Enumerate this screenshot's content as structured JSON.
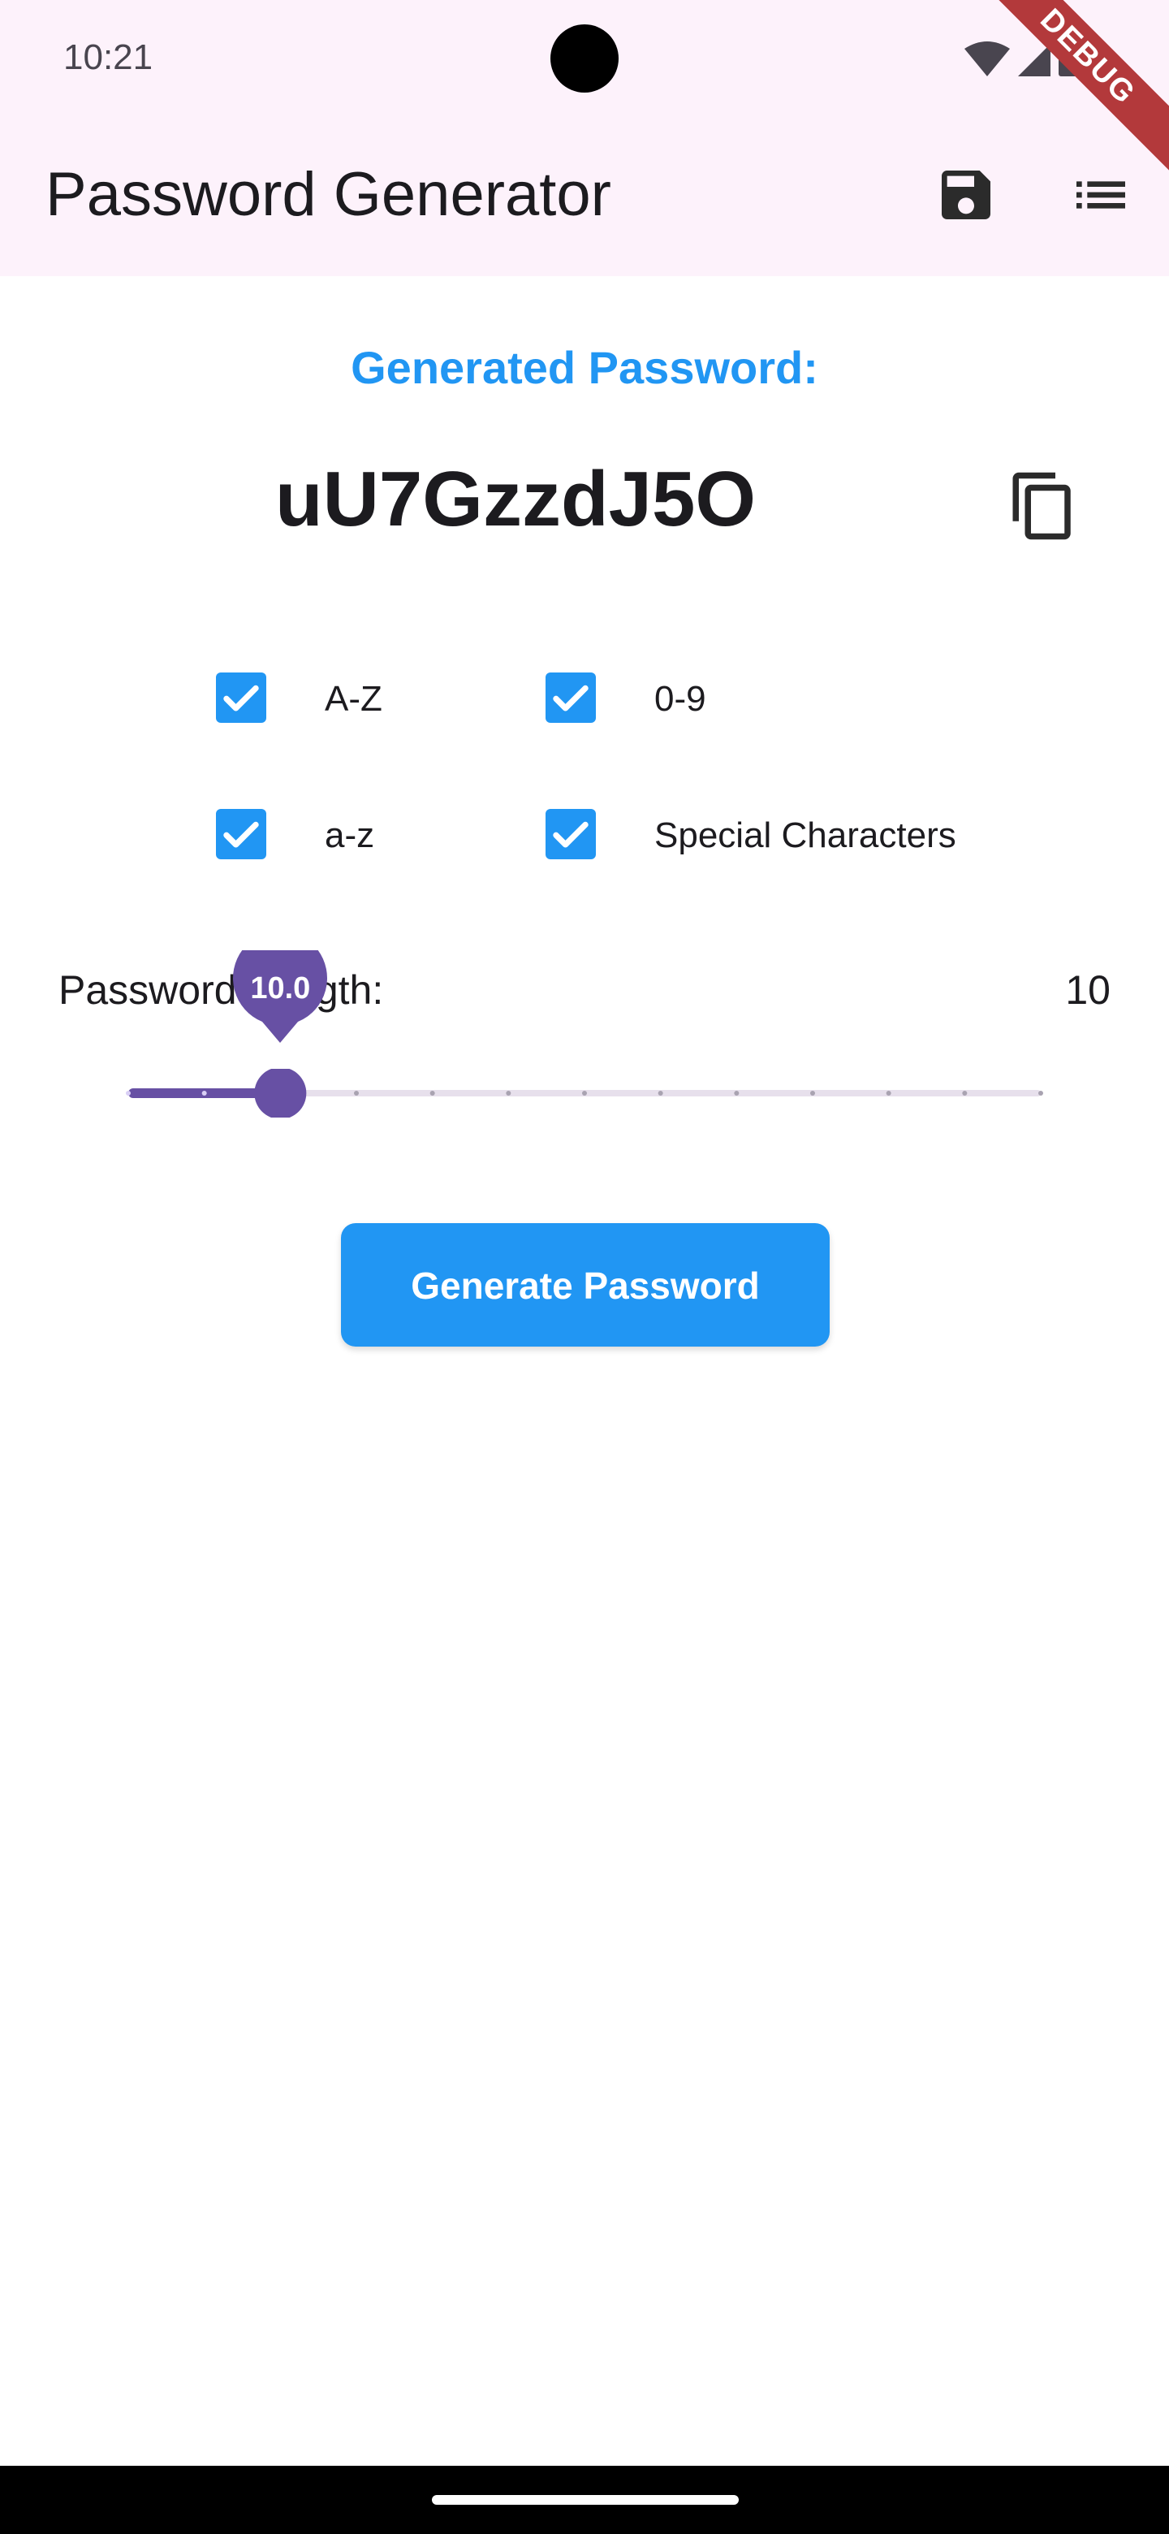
{
  "status_bar": {
    "time": "10:21"
  },
  "app_bar": {
    "title": "Password Generator",
    "debug_label": "DEBUG",
    "save_icon": "save-icon",
    "list_icon": "list-icon"
  },
  "generated": {
    "label": "Generated Password:",
    "password": "uU7GzzdJ5O",
    "copy_icon": "copy-icon"
  },
  "options": [
    {
      "label": "A-Z",
      "checked": true
    },
    {
      "label": "0-9",
      "checked": true
    },
    {
      "label": "a-z",
      "checked": true
    },
    {
      "label": "Special Characters",
      "checked": true
    }
  ],
  "length": {
    "label": "Password Length:",
    "value": "10",
    "slider_tooltip": "10.0",
    "slider_value": 10,
    "slider_min": 8,
    "slider_max": 20
  },
  "generate_button": {
    "label": "Generate Password"
  },
  "colors": {
    "accent": "#2196f3",
    "slider": "#6750a4",
    "appbar_bg": "#fdf2fb",
    "debug_ribbon": "#b3393b"
  }
}
